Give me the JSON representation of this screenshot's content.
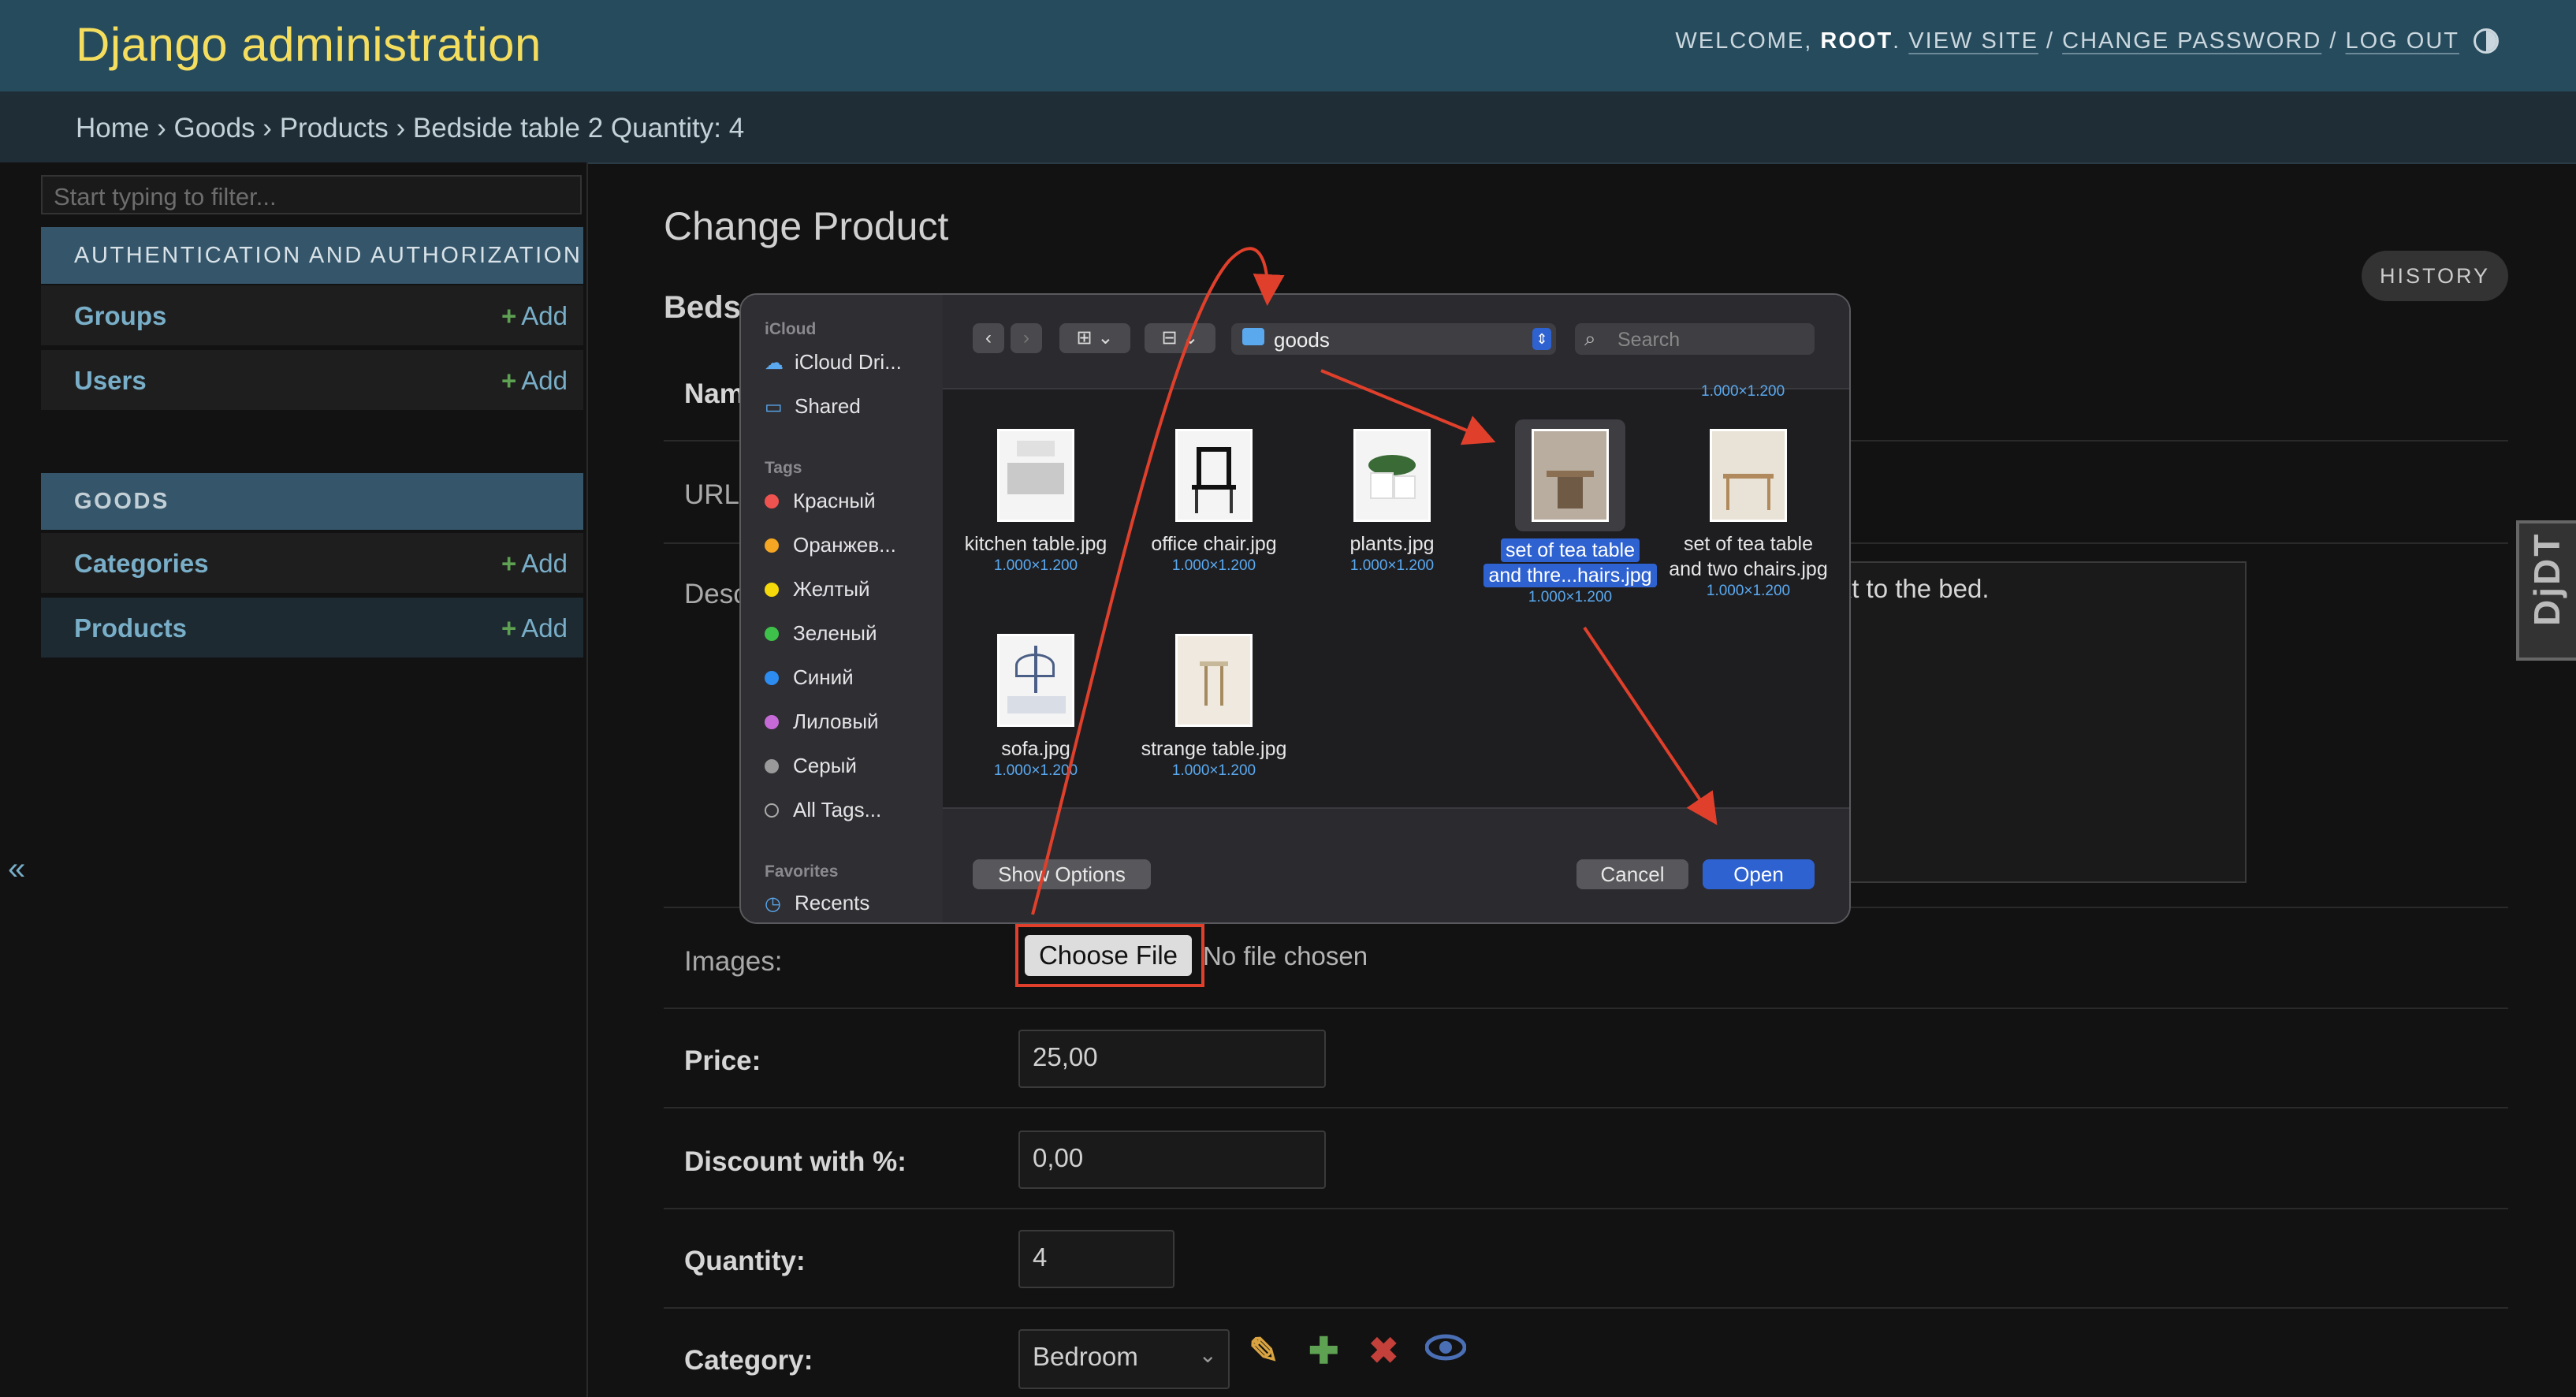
{
  "header": {
    "branding": "Django administration",
    "welcome": "WELCOME,",
    "user": "ROOT",
    "view_site": "VIEW SITE",
    "change_password": "CHANGE PASSWORD",
    "log_out": "LOG OUT",
    "sep": "/"
  },
  "breadcrumbs": "Home › Goods › Products › Bedside table 2 Quantity: 4",
  "sidebar": {
    "filter_placeholder": "Start typing to filter...",
    "auth_caption": "AUTHENTICATION AND AUTHORIZATION",
    "goods_caption": "GOODS",
    "add_label": "Add",
    "items": [
      "Groups",
      "Users",
      "Categories",
      "Products"
    ],
    "collapse": "«"
  },
  "content": {
    "title": "Change Product",
    "history": "HISTORY",
    "object_title": "Beds",
    "name_label": "Nam",
    "url_label": "URL",
    "desc_label": "Desc",
    "desc_text": "next to the bed.",
    "images_label": "Images:",
    "choose_file": "Choose File",
    "no_file": "No file chosen",
    "price_label": "Price:",
    "price_value": "25,00",
    "discount_label": "Discount with %:",
    "discount_value": "0,00",
    "quantity_label": "Quantity:",
    "quantity_value": "4",
    "category_label": "Category:",
    "category_value": "Bedroom"
  },
  "djdt": "DjDT",
  "dialog": {
    "icloud_caption": "iCloud",
    "icloud_drive": "iCloud Dri...",
    "shared": "Shared",
    "tags_caption": "Tags",
    "tags": [
      {
        "name": "Красный",
        "color": "#ef5350"
      },
      {
        "name": "Оранжев...",
        "color": "#f5a623"
      },
      {
        "name": "Желтый",
        "color": "#f5d90a"
      },
      {
        "name": "Зеленый",
        "color": "#3ec14a"
      },
      {
        "name": "Синий",
        "color": "#2d8cf0"
      },
      {
        "name": "Лиловый",
        "color": "#c66ad8"
      },
      {
        "name": "Серый",
        "color": "#9a9a9a"
      }
    ],
    "all_tags": "All Tags...",
    "favorites_caption": "Favorites",
    "recents": "Recents",
    "folder": "goods",
    "search_placeholder": "Search",
    "top_size": "1.000×1.200",
    "files": [
      {
        "name": "kitchen table.jpg",
        "size": "1.000×1.200"
      },
      {
        "name": "office chair.jpg",
        "size": "1.000×1.200"
      },
      {
        "name": "plants.jpg",
        "size": "1.000×1.200"
      },
      {
        "name": "set of tea table and thre...hairs.jpg",
        "line1": "set of tea table",
        "line2": "and thre...hairs.jpg",
        "size": "1.000×1.200"
      },
      {
        "name": "set of tea table and two chairs.jpg",
        "line1": "set of tea table",
        "line2": "and two chairs.jpg",
        "size": "1.000×1.200"
      },
      {
        "name": "sofa.jpg",
        "size": "1.000×1.200"
      },
      {
        "name": "strange table.jpg",
        "size": "1.000×1.200"
      }
    ],
    "show_options": "Show Options",
    "cancel": "Cancel",
    "open": "Open"
  }
}
